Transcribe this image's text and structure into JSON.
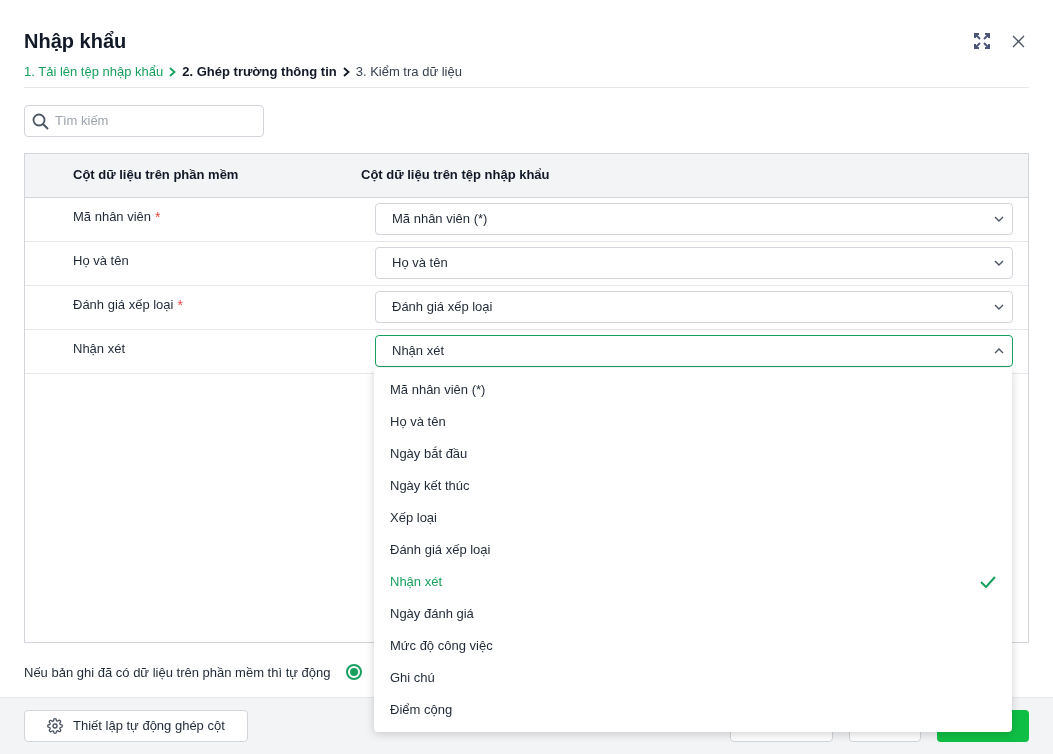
{
  "dialog": {
    "title": "Nhập khẩu"
  },
  "steps": [
    {
      "label": "1. Tải lên tệp nhập khẩu",
      "completed": true,
      "selected": false
    },
    {
      "label": "2. Ghép trường thông tin",
      "completed": false,
      "selected": true
    },
    {
      "label": "3. Kiểm tra dữ liệu",
      "completed": false,
      "selected": false
    }
  ],
  "search": {
    "placeholder": "Tìm kiếm"
  },
  "table": {
    "columns": [
      "Cột dữ liệu trên phần mềm",
      "Cột dữ liệu trên tệp nhập khẩu"
    ],
    "rows": [
      {
        "field": "Mã nhân viên",
        "required_mark": "*",
        "value": "Mã nhân viên (*)",
        "open": false
      },
      {
        "field": "Họ và tên",
        "value": "Họ và tên",
        "open": false
      },
      {
        "field": "Đánh giá xếp loại",
        "required_mark": "*",
        "value": "Đánh giá xếp loại",
        "open": false
      },
      {
        "field": "Nhận xét",
        "value": "Nhận xét",
        "open": true
      }
    ]
  },
  "dropdown": {
    "options": [
      {
        "label": "Mã nhân viên (*)",
        "selected": false
      },
      {
        "label": "Họ và tên",
        "selected": false
      },
      {
        "label": "Ngày bắt đầu",
        "selected": false
      },
      {
        "label": "Ngày kết thúc",
        "selected": false
      },
      {
        "label": "Xếp loại",
        "selected": false
      },
      {
        "label": "Đánh giá xếp loại",
        "selected": false
      },
      {
        "label": "Nhận xét",
        "selected": true
      },
      {
        "label": "Ngày đánh giá",
        "selected": false
      },
      {
        "label": "Mức độ công việc",
        "selected": false
      },
      {
        "label": "Ghi chú",
        "selected": false
      },
      {
        "label": "Điểm cộng",
        "selected": false
      }
    ]
  },
  "overwrite": {
    "label": "Nếu bản ghi đã có dữ liệu trên phần mềm thì tự động",
    "option": {
      "selected": true
    }
  },
  "footer": {
    "auto_match_button": "Thiết lập tự động ghép cột"
  }
}
